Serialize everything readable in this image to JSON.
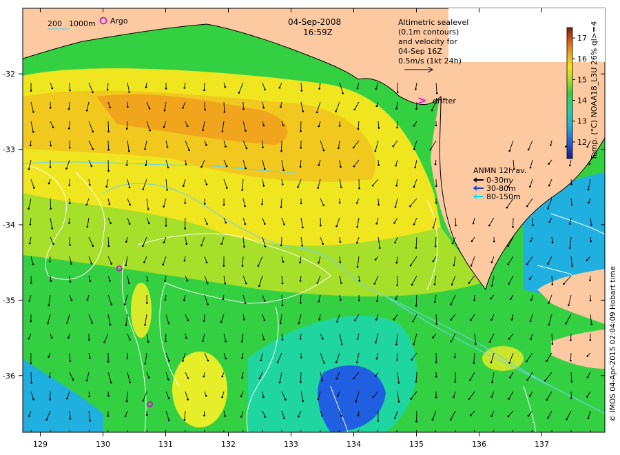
{
  "header": {
    "date": "04-Sep-2008",
    "time": "16:59Z"
  },
  "scale_bar": {
    "label_a": "200",
    "label_b": "1000m"
  },
  "argo": {
    "label": "Argo",
    "color": "#cc00cc"
  },
  "altimetry_note": {
    "lines": [
      "Altimetric sealevel",
      "(0.1m contours)",
      "and velocity for",
      "04-Sep 16Z",
      "0.5m/s (1kt 24h)"
    ]
  },
  "drifter": {
    "symbol": ">",
    "label": "drifter",
    "color": "#ff00ff"
  },
  "anmn_legend": {
    "title": "ANMN 12h av.",
    "items": [
      {
        "label": "0-30m",
        "color": "#000000"
      },
      {
        "label": "30-80m",
        "color": "#1a3cd0"
      },
      {
        "label": "80-150m",
        "color": "#00e5ee"
      }
    ]
  },
  "colorbar": {
    "label": "Temp. (°C) NOAA18_L3U 26% ql>=4",
    "ticks": [
      12,
      13,
      14,
      15,
      16,
      17
    ],
    "min": 11.2,
    "max": 17.5
  },
  "axes": {
    "x_ticks": [
      "129",
      "130",
      "131",
      "132",
      "133",
      "134",
      "135",
      "136",
      "137"
    ],
    "y_ticks": [
      "-32",
      "-33",
      "-34",
      "-35",
      "-36"
    ]
  },
  "credit": "© IMOS 04-Apr-2015 02:04:09 Hobart time",
  "colors": {
    "land": "#fcc9a0",
    "sst_cold": "#1f5fe0",
    "sst_mid": "#33d142",
    "sst_warm": "#f0a51c",
    "bathymetry": "#ffffff",
    "contour_cyan": "#6fd3e8"
  },
  "argo_floats": [
    {
      "lon": 130.26,
      "lat": -34.58
    },
    {
      "lon": 130.75,
      "lat": -36.38
    }
  ]
}
